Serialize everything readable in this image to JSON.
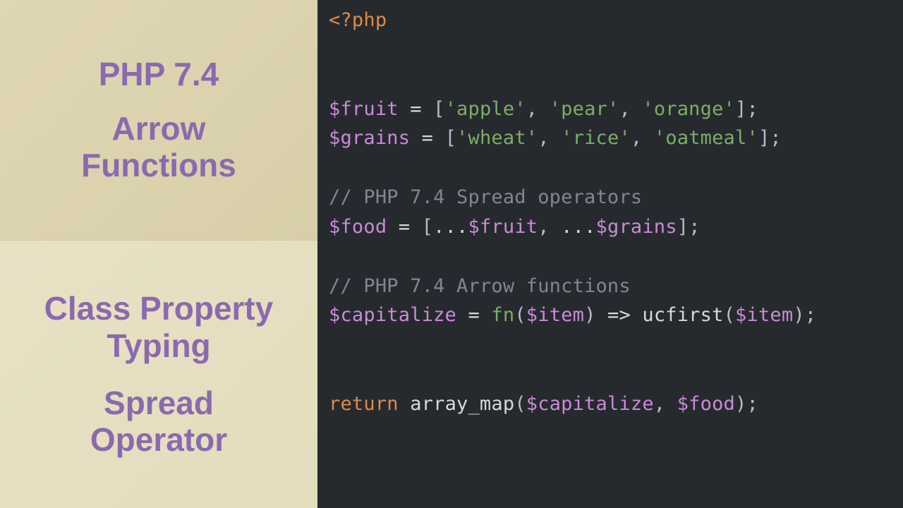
{
  "left": {
    "top": {
      "title1": "PHP 7.4",
      "title2_line1": "Arrow",
      "title2_line2": "Functions"
    },
    "bottom": {
      "title1_line1": "Class Property",
      "title1_line2": "Typing",
      "title2_line1": "Spread",
      "title2_line2": "Operator"
    }
  },
  "code": {
    "open_tag": "<?php",
    "var_fruit": "$fruit",
    "var_grains": "$grains",
    "var_food": "$food",
    "var_capitalize": "$capitalize",
    "var_item": "$item",
    "str_apple": "'apple'",
    "str_pear": "'pear'",
    "str_orange": "'orange'",
    "str_wheat": "'wheat'",
    "str_rice": "'rice'",
    "str_oatmeal": "'oatmeal'",
    "comment_spread": "// PHP 7.4 Spread operators",
    "comment_arrow": "// PHP 7.4 Arrow functions",
    "kw_return": "return",
    "kw_fn": "fn",
    "func_ucfirst": "ucfirst",
    "func_array_map": "array_map",
    "eq": " = ",
    "arrow": " => ",
    "spread": "...",
    "lbr": "[",
    "rbr": "]",
    "lpar": "(",
    "rpar": ")",
    "comma": ", ",
    "semi": ";"
  }
}
